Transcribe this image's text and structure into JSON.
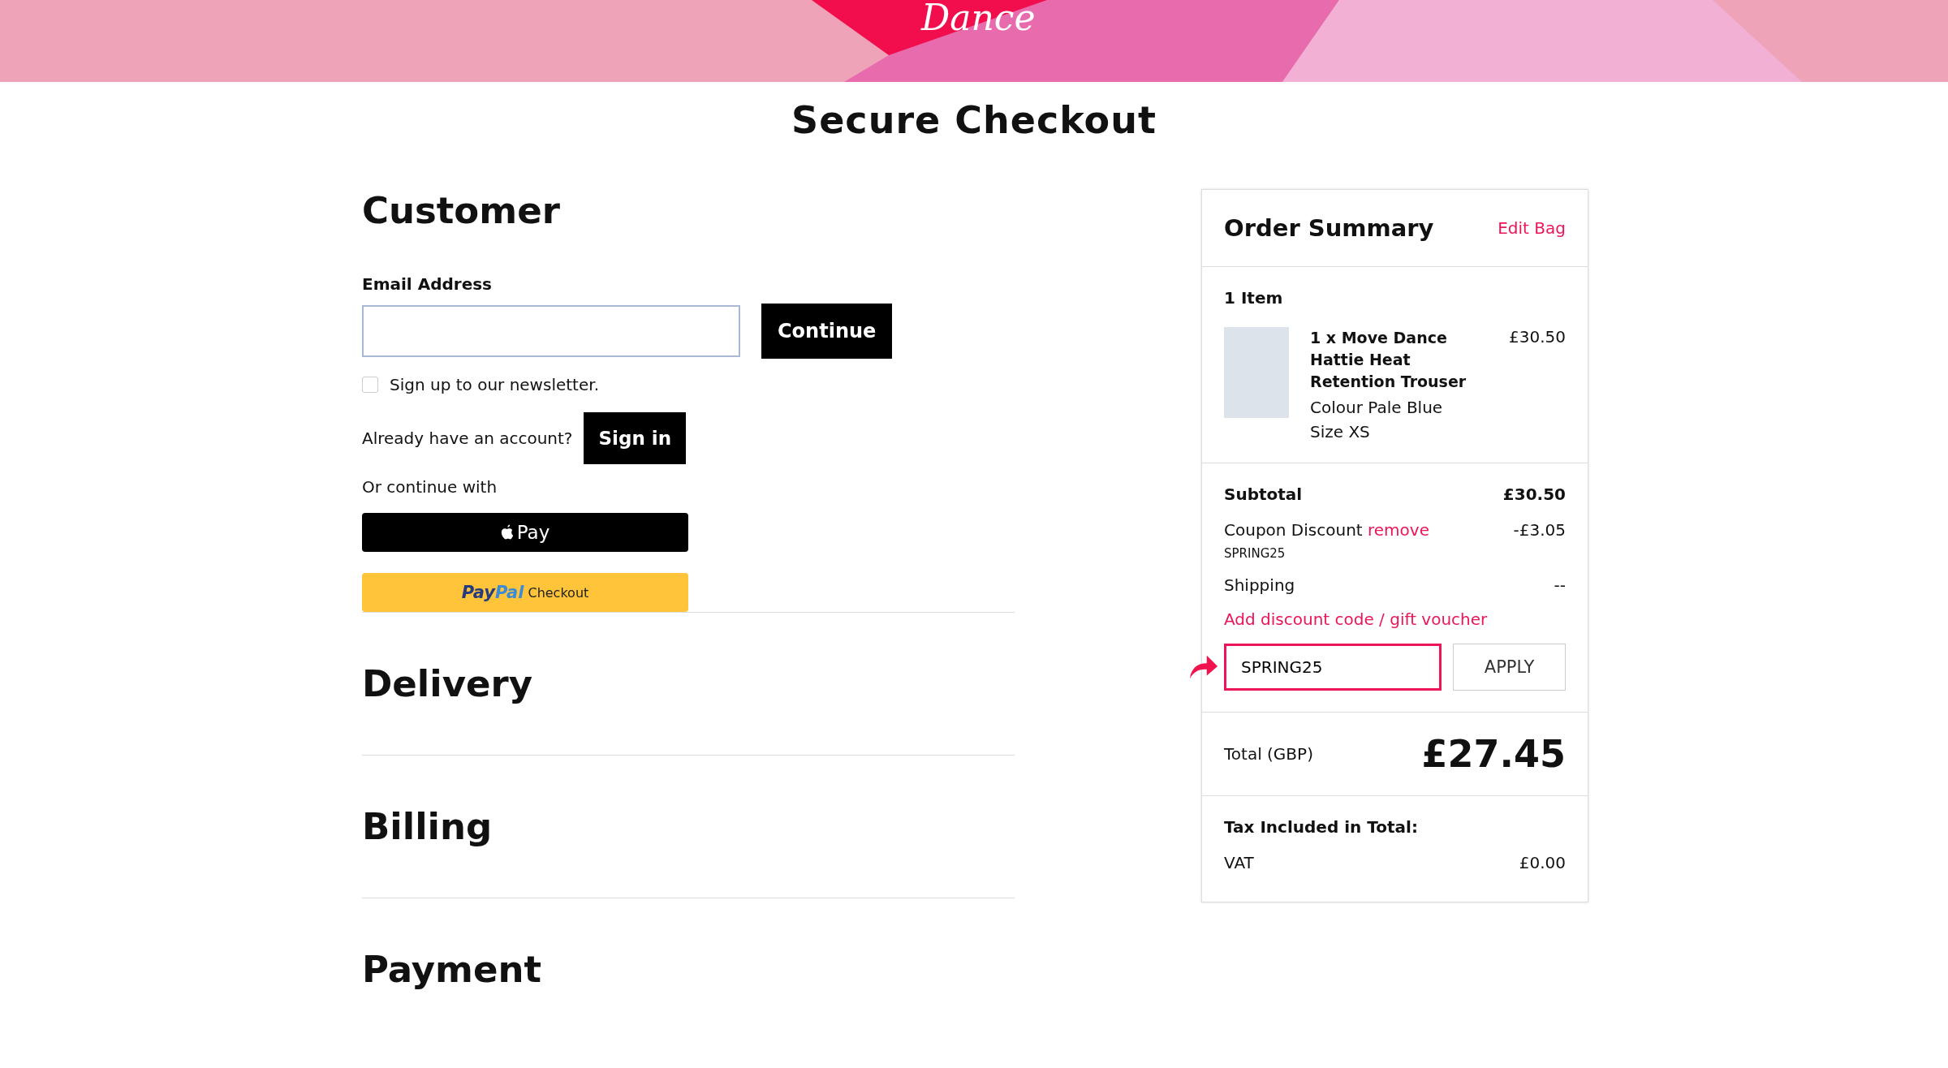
{
  "banner": {
    "logo": "Dance"
  },
  "page_title": "Secure Checkout",
  "customer": {
    "heading": "Customer",
    "email_label": "Email Address",
    "continue_button": "Continue",
    "newsletter": {
      "label": "Sign up to our newsletter.",
      "checked": false
    },
    "account_prompt": "Already have an account?",
    "sign_in_button": "Sign in",
    "alt_prompt": "Or continue with",
    "apple_pay": "Pay",
    "paypal": {
      "brand_first": "Pay",
      "brand_second": "Pal",
      "label": "Checkout"
    }
  },
  "sections": [
    {
      "heading": "Delivery"
    },
    {
      "heading": "Billing"
    },
    {
      "heading": "Payment"
    }
  ],
  "order_summary": {
    "title": "Order Summary",
    "edit_link": "Edit Bag",
    "item_count": "1 Item",
    "items": [
      {
        "name": "1 x Move Dance Hattie Heat Retention Trouser",
        "colour": "Colour Pale Blue",
        "size": "Size XS",
        "price": "£30.50"
      }
    ],
    "subtotal": {
      "label": "Subtotal",
      "value": "£30.50"
    },
    "coupon": {
      "label": "Coupon Discount",
      "remove": "remove",
      "code": "SPRING25",
      "value": "-£3.05"
    },
    "shipping": {
      "label": "Shipping",
      "value": "--"
    },
    "discount_link": "Add discount code / gift voucher",
    "discount_input": "SPRING25",
    "apply_button": "APPLY",
    "total": {
      "label": "Total (GBP)",
      "value": "£27.45"
    },
    "tax": {
      "heading": "Tax Included in Total:",
      "label": "VAT",
      "value": "£0.00"
    }
  }
}
